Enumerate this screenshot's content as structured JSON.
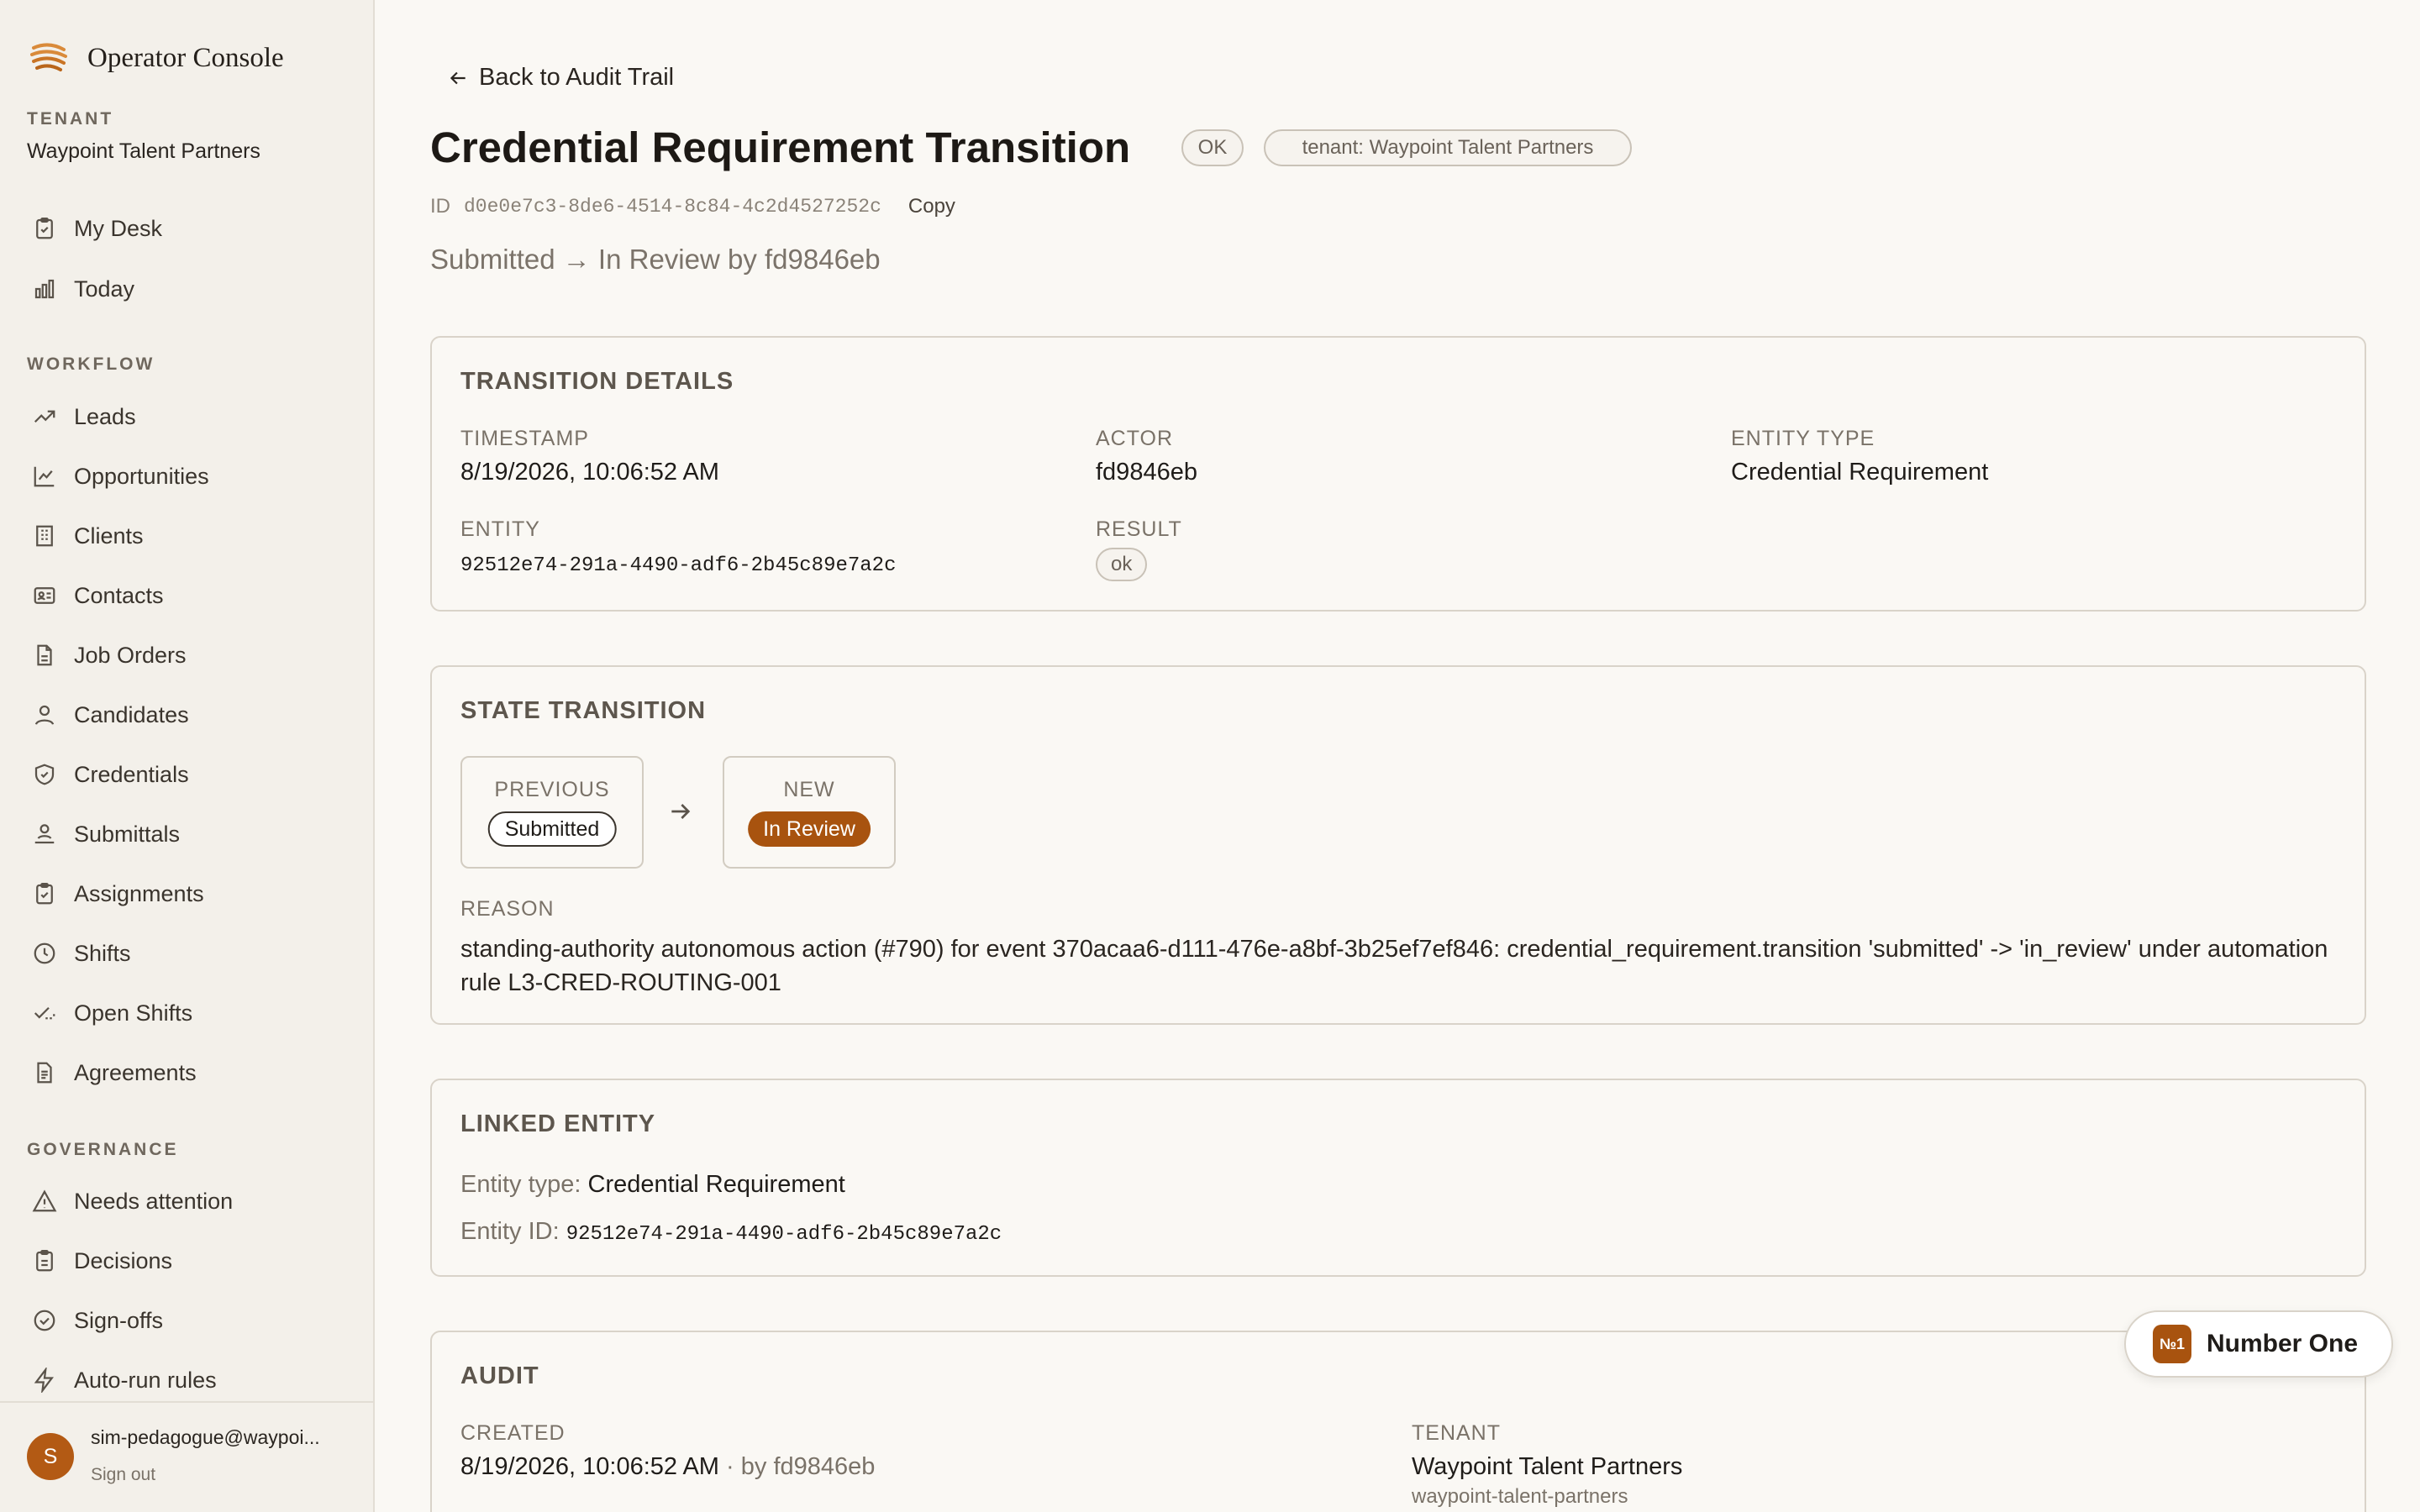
{
  "app": {
    "name": "Operator Console"
  },
  "tenant": {
    "label": "TENANT",
    "name": "Waypoint Talent Partners"
  },
  "nav_top": [
    {
      "label": "My Desk",
      "icon": "clipboard-icon"
    },
    {
      "label": "Today",
      "icon": "bar-chart-icon"
    }
  ],
  "workflow": {
    "label": "WORKFLOW",
    "items": [
      {
        "label": "Leads",
        "icon": "trending-up-icon"
      },
      {
        "label": "Opportunities",
        "icon": "line-chart-icon"
      },
      {
        "label": "Clients",
        "icon": "building-icon"
      },
      {
        "label": "Contacts",
        "icon": "contact-card-icon"
      },
      {
        "label": "Job Orders",
        "icon": "document-icon"
      },
      {
        "label": "Candidates",
        "icon": "person-icon"
      },
      {
        "label": "Credentials",
        "icon": "shield-check-icon"
      },
      {
        "label": "Submittals",
        "icon": "person-stand-icon"
      },
      {
        "label": "Assignments",
        "icon": "clipboard-check-icon"
      },
      {
        "label": "Shifts",
        "icon": "clock-icon"
      },
      {
        "label": "Open Shifts",
        "icon": "check-dashed-icon"
      },
      {
        "label": "Agreements",
        "icon": "document-lines-icon"
      }
    ]
  },
  "governance": {
    "label": "GOVERNANCE",
    "items": [
      {
        "label": "Needs attention",
        "icon": "warning-triangle-icon"
      },
      {
        "label": "Decisions",
        "icon": "clipboard-list-icon"
      },
      {
        "label": "Sign-offs",
        "icon": "check-circle-icon"
      },
      {
        "label": "Auto-run rules",
        "icon": "lightning-icon"
      }
    ]
  },
  "user": {
    "initial": "S",
    "email": "sim-pedagogue@waypoi...",
    "sign_out": "Sign out"
  },
  "header": {
    "back_label": "Back to Audit Trail",
    "title": "Credential Requirement Transition",
    "status_badge": "OK",
    "tenant_badge": "tenant: Waypoint Talent Partners",
    "id_label": "ID",
    "id_value": "d0e0e7c3-8de6-4514-8c84-4c2d4527252c",
    "copy_label": "Copy",
    "subtitle": "Submitted → In Review by fd9846eb"
  },
  "transition_details": {
    "title": "TRANSITION DETAILS",
    "timestamp_label": "TIMESTAMP",
    "timestamp": "8/19/2026, 10:06:52 AM",
    "actor_label": "ACTOR",
    "actor": "fd9846eb",
    "entity_type_label": "ENTITY TYPE",
    "entity_type": "Credential Requirement",
    "entity_label": "ENTITY",
    "entity": "92512e74-291a-4490-adf6-2b45c89e7a2c",
    "result_label": "RESULT",
    "result": "ok"
  },
  "state_transition": {
    "title": "STATE TRANSITION",
    "previous_label": "PREVIOUS",
    "previous": "Submitted",
    "new_label": "NEW",
    "new": "In Review",
    "reason_label": "REASON",
    "reason": "standing-authority autonomous action (#790) for event 370acaa6-d111-476e-a8bf-3b25ef7ef846: credential_requirement.transition 'submitted' -> 'in_review' under automation rule L3-CRED-ROUTING-001"
  },
  "linked_entity": {
    "title": "LINKED ENTITY",
    "type_label": "Entity type:",
    "type": "Credential Requirement",
    "id_label": "Entity ID:",
    "id": "92512e74-291a-4490-adf6-2b45c89e7a2c"
  },
  "audit": {
    "title": "AUDIT",
    "created_label": "CREATED",
    "created": "8/19/2026, 10:06:52 AM",
    "created_by": "· by fd9846eb",
    "tenant_label": "TENANT",
    "tenant_name": "Waypoint Talent Partners",
    "tenant_slug": "waypoint-talent-partners"
  },
  "assistant": {
    "badge": "№1",
    "label": "Number One"
  },
  "colors": {
    "accent": "#a8530f",
    "background": "#faf8f4",
    "sidebar": "#f3f0ea"
  }
}
